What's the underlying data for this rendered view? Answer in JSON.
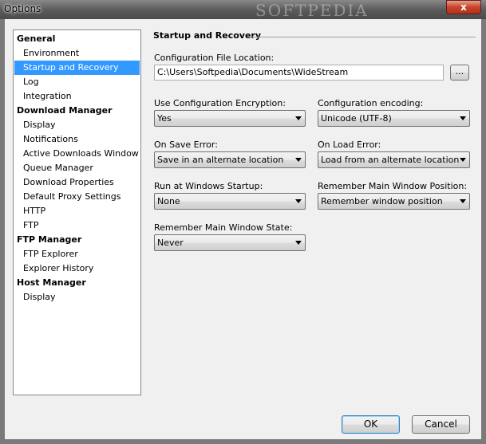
{
  "window": {
    "title": "Options",
    "watermark": "SOFTPEDIA",
    "close_glyph": "x"
  },
  "tree": {
    "items": [
      {
        "label": "General",
        "kind": "category"
      },
      {
        "label": "Environment",
        "kind": "item"
      },
      {
        "label": "Startup and Recovery",
        "kind": "item",
        "selected": true
      },
      {
        "label": "Log",
        "kind": "item"
      },
      {
        "label": "Integration",
        "kind": "item"
      },
      {
        "label": "Download Manager",
        "kind": "category"
      },
      {
        "label": "Display",
        "kind": "item"
      },
      {
        "label": "Notifications",
        "kind": "item"
      },
      {
        "label": "Active Downloads Window",
        "kind": "item"
      },
      {
        "label": "Queue Manager",
        "kind": "item"
      },
      {
        "label": "Download Properties",
        "kind": "item"
      },
      {
        "label": "Default Proxy Settings",
        "kind": "item"
      },
      {
        "label": "HTTP",
        "kind": "item"
      },
      {
        "label": "FTP",
        "kind": "item"
      },
      {
        "label": "FTP Manager",
        "kind": "category"
      },
      {
        "label": "FTP Explorer",
        "kind": "item"
      },
      {
        "label": "Explorer History",
        "kind": "item"
      },
      {
        "label": "Host Manager",
        "kind": "category"
      },
      {
        "label": "Display",
        "kind": "item"
      }
    ]
  },
  "section": {
    "title": "Startup and Recovery",
    "config_location": {
      "label": "Configuration File Location:",
      "value": "C:\\Users\\Softpedia\\Documents\\WideStream",
      "browse_label": "..."
    },
    "encryption": {
      "label": "Use Configuration Encryption:",
      "value": "Yes"
    },
    "encoding": {
      "label": "Configuration encoding:",
      "value": "Unicode (UTF-8)"
    },
    "save_error": {
      "label": "On Save Error:",
      "value": "Save in an alternate location"
    },
    "load_error": {
      "label": "On Load Error:",
      "value": "Load from an alternate location"
    },
    "windows_startup": {
      "label": "Run at Windows Startup:",
      "value": "None"
    },
    "remember_position": {
      "label": "Remember Main Window Position:",
      "value": "Remember window position"
    },
    "remember_state": {
      "label": "Remember Main Window State:",
      "value": "Never"
    }
  },
  "buttons": {
    "ok": "OK",
    "cancel": "Cancel"
  },
  "colors": {
    "selection": "#3399ff",
    "default_button_border": "#3c7fb1"
  }
}
